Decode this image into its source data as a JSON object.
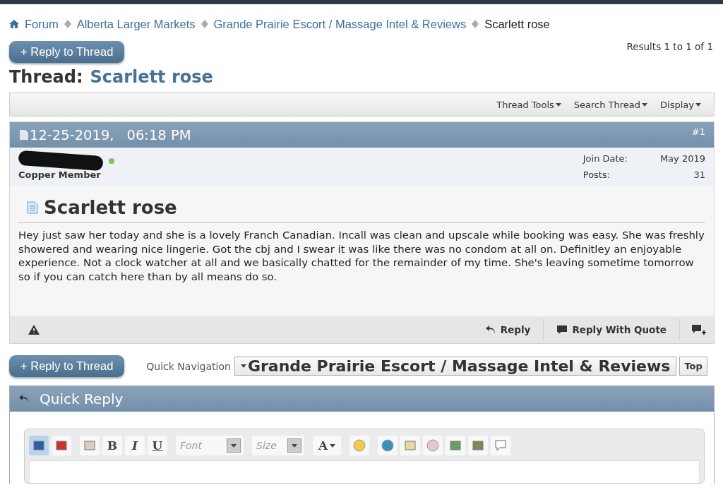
{
  "breadcrumbs": [
    {
      "label": "Forum",
      "current": false
    },
    {
      "label": "Alberta Larger Markets",
      "current": false
    },
    {
      "label": "Grande Prairie Escort / Massage Intel & Reviews",
      "current": false
    },
    {
      "label": "Scarlett rose",
      "current": true
    }
  ],
  "reply_button": "+ Reply to Thread",
  "results": "Results 1 to 1 of 1",
  "thread_title": {
    "prefix": "Thread:",
    "name": "Scarlett rose"
  },
  "thread_tools": [
    "Thread Tools",
    "Search Thread",
    "Display"
  ],
  "post": {
    "date": "12-25-2019,",
    "time": "06:18 PM",
    "number": "#1",
    "user": {
      "rank": "Copper Member",
      "online": true
    },
    "info": [
      {
        "label": "Join Date:",
        "value": "May 2019"
      },
      {
        "label": "Posts:",
        "value": "31"
      }
    ],
    "title": "Scarlett rose",
    "body": "Hey just saw her today and she is a lovely Franch Canadian. Incall was clean and upscale while booking was easy. She was freshly showered and wearing nice lingerie. Got the cbj and I swear it was like there was no condom at all on. Definitley an enjoyable experience. Not a clock watcher at all and we basically chatted for the remainder of my time. She's leaving sometime tomorrow so if you can catch here than by all means do so.",
    "actions": [
      "Reply",
      "Reply With Quote"
    ]
  },
  "bottom": {
    "reply_button": "+ Reply to Thread",
    "nav_label": "Quick Navigation",
    "nav_value": "Grande Prairie Escort / Massage Intel & Reviews",
    "top_button": "Top"
  },
  "quick_reply": {
    "title": "Quick Reply",
    "toolbar": [
      {
        "kind": "icon",
        "selected": true
      },
      {
        "kind": "icon",
        "selected": false
      },
      {
        "kind": "sep"
      },
      {
        "kind": "icon",
        "selected": false
      },
      {
        "kind": "letter",
        "label": "B"
      },
      {
        "kind": "letter",
        "label": "I"
      },
      {
        "kind": "letter",
        "label": "U"
      },
      {
        "kind": "sep"
      },
      {
        "kind": "select",
        "placeholder": "Font"
      },
      {
        "kind": "sep"
      },
      {
        "kind": "select",
        "placeholder": "Size"
      },
      {
        "kind": "sep"
      },
      {
        "kind": "color",
        "label": "A"
      },
      {
        "kind": "sep"
      },
      {
        "kind": "icon",
        "selected": false
      },
      {
        "kind": "sep"
      },
      {
        "kind": "icon",
        "selected": false
      },
      {
        "kind": "icon",
        "selected": false
      },
      {
        "kind": "icon",
        "selected": false
      },
      {
        "kind": "icon",
        "selected": false
      },
      {
        "kind": "icon",
        "selected": false
      },
      {
        "kind": "icon",
        "selected": false
      }
    ]
  }
}
